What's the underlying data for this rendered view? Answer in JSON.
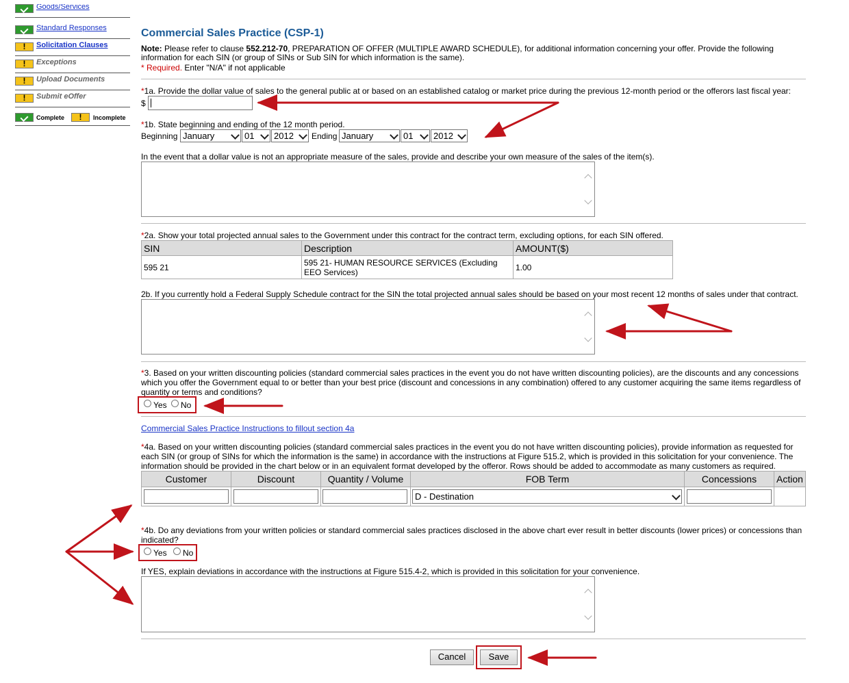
{
  "sidebar": {
    "items": [
      {
        "label": "Goods/Services",
        "status": "complete",
        "style": "link"
      },
      {
        "label": "Standard Responses",
        "status": "complete",
        "style": "link"
      },
      {
        "label": "Solicitation Clauses",
        "status": "incomplete",
        "style": "link-bold"
      },
      {
        "label": "Exceptions",
        "status": "incomplete",
        "style": "disabled"
      },
      {
        "label": "Upload Documents",
        "status": "incomplete",
        "style": "disabled"
      },
      {
        "label": "Submit eOffer",
        "status": "incomplete",
        "style": "disabled"
      }
    ],
    "legend": {
      "complete": "Complete",
      "incomplete": "Incomplete"
    }
  },
  "page": {
    "title": "Commercial Sales Practice (CSP-1)",
    "note_label": "Note:",
    "note_pre": " Please refer to clause ",
    "note_clause": "552.212-70",
    "note_post1": ", PREPARATION OF OFFER (MULTIPLE AWARD SCHEDULE), for additional information concerning your offer. Provide the following",
    "note_post2": "information for each SIN (or group of SINs or Sub SIN for which information is the same).",
    "required_mark": "* Required.",
    "na_text": " Enter \"N/A\" if not applicable"
  },
  "q1a": {
    "label": "1a. Provide the dollar value of sales to the general public at or based on an established catalog or market price during the previous 12-month period or the offerors last fiscal year:",
    "currency": "$",
    "value": ""
  },
  "q1b": {
    "label": "1b. State beginning and ending of the 12 month period.",
    "beginning_label": "Beginning",
    "ending_label": "Ending",
    "begin_month": "January",
    "begin_day": "01",
    "begin_year": "2012",
    "end_month": "January",
    "end_day": "01",
    "end_year": "2012"
  },
  "q1c": {
    "label": "In the event that a dollar value is not an appropriate measure of the sales, provide and describe your own measure of the sales of the item(s)."
  },
  "q2a": {
    "label": "2a. Show your total projected annual sales to the Government under this contract for the contract term, excluding options, for each SIN offered.",
    "headers": [
      "SIN",
      "Description",
      "AMOUNT($)"
    ],
    "rows": [
      {
        "sin": "595 21",
        "description": "595 21- HUMAN RESOURCE SERVICES (Excluding EEO Services)",
        "amount": "1.00"
      }
    ]
  },
  "q2b": {
    "label": "2b. If you currently hold a Federal Supply Schedule contract for the SIN the total projected annual sales should be based on your most recent 12 months of sales under that contract."
  },
  "q3": {
    "line1": "3. Based on your written discounting policies (standard commercial sales practices in the event you do not have written discounting policies), are the discounts and any concessions",
    "line2": "which you offer the Government equal to or better than your best price (discount and concessions in any combination) offered to any customer acquiring the same items regardless of",
    "line3": "quantity or terms and conditions?",
    "yes": "Yes",
    "no": "No"
  },
  "instructions_link": "Commercial Sales Practice Instructions to fillout section 4a",
  "q4a": {
    "line1": "4a. Based on your written discounting policies (standard commercial sales practices in the event you do not have written discounting policies), provide information as requested for",
    "line2": "each SIN (or group of SINs for which the information is the same) in accordance with the instructions at Figure 515.2, which is provided in this solicitation for your convenience. The",
    "line3": "information should be provided in the chart below or in an equivalent format developed by the offeror. Rows should be added to accommodate as many customers as required.",
    "headers": [
      "Customer",
      "Discount",
      "Quantity / Volume",
      "FOB Term",
      "Concessions",
      "Action"
    ],
    "fob_value": "D - Destination"
  },
  "q4b": {
    "line1": "4b. Do any deviations from your written policies or standard commercial sales practices disclosed in the above chart ever result in better discounts (lower prices) or concessions than",
    "line2": "indicated?",
    "yes": "Yes",
    "no": "No",
    "explain": "If YES, explain deviations in accordance with the instructions at Figure 515.4-2, which is provided in this solicitation for your convenience."
  },
  "buttons": {
    "cancel": "Cancel",
    "save": "Save"
  },
  "colors": {
    "title": "#1b5b97",
    "link": "#1a35c7",
    "required": "#cc0000",
    "annotation_arrow": "#c0141b",
    "complete": "#2e9a2e",
    "incomplete": "#f5c31a"
  }
}
